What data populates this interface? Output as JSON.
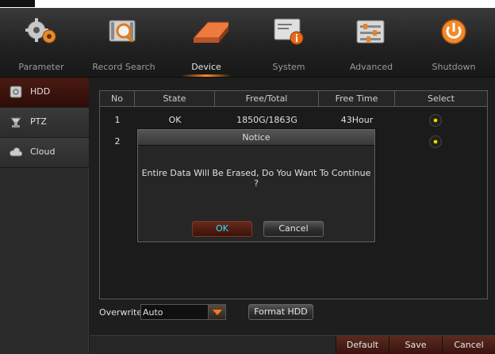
{
  "nav": {
    "items": [
      {
        "label": "Parameter",
        "icon": "gears-icon"
      },
      {
        "label": "Record Search",
        "icon": "record-search-icon"
      },
      {
        "label": "Device",
        "icon": "hard-disk-icon",
        "active": true
      },
      {
        "label": "System",
        "icon": "system-info-icon"
      },
      {
        "label": "Advanced",
        "icon": "sliders-icon"
      },
      {
        "label": "Shutdown",
        "icon": "power-icon"
      }
    ]
  },
  "sidebar": {
    "items": [
      {
        "label": "HDD",
        "icon": "hdd-icon",
        "active": true
      },
      {
        "label": "PTZ",
        "icon": "ptz-camera-icon"
      },
      {
        "label": "Cloud",
        "icon": "cloud-icon"
      }
    ]
  },
  "table": {
    "headers": [
      "No",
      "State",
      "Free/Total",
      "Free Time",
      "Select"
    ],
    "rows": [
      {
        "no": "1",
        "state": "OK",
        "free_total": "1850G/1863G",
        "free_time": "43Hour",
        "selected": true
      },
      {
        "no": "2",
        "state": "",
        "free_total": "",
        "free_time": "",
        "selected": true
      }
    ]
  },
  "controls": {
    "overwrite_label": "Overwrite",
    "overwrite_value": "Auto",
    "format_button": "Format HDD"
  },
  "footer": {
    "default_label": "Default",
    "save_label": "Save",
    "cancel_label": "Cancel"
  },
  "modal": {
    "title": "Notice",
    "message": "Entire Data Will Be Erased, Do You Want To Continue ?",
    "ok_label": "OK",
    "cancel_label": "Cancel"
  },
  "colors": {
    "accent": "#ff8a1e",
    "select_dot": "#f4e400",
    "ok_text": "#1ee6ff",
    "active_side": "#4a1a12"
  }
}
